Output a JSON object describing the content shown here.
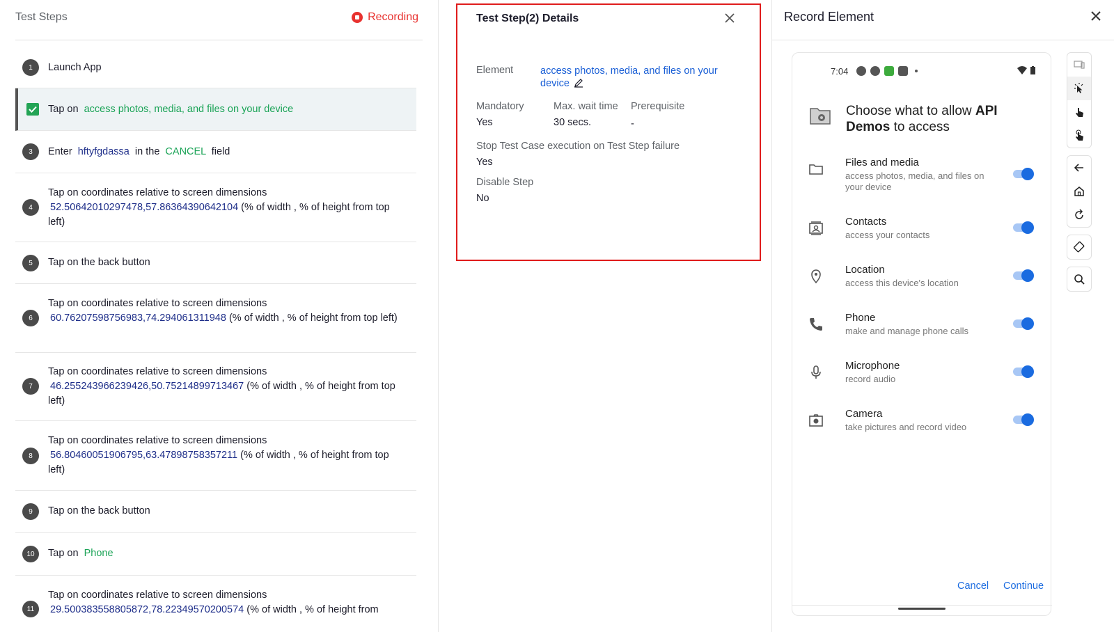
{
  "left": {
    "title": "Test Steps",
    "recording_label": "Recording",
    "steps": [
      {
        "num": "1",
        "text": "Launch App"
      },
      {
        "num": "2",
        "prefix": "Tap on",
        "element": "access photos, media, and files on your device"
      },
      {
        "num": "3",
        "prefix": "Enter",
        "value": "hftyfgdassa",
        "mid": "in the",
        "field": "CANCEL",
        "suffix": "field"
      },
      {
        "num": "4",
        "line1": "Tap on coordinates relative to screen dimensions",
        "coords": "52.50642010297478,57.86364390642104",
        "tail": "(% of width , % of height from top left)"
      },
      {
        "num": "5",
        "text": "Tap on the back button"
      },
      {
        "num": "6",
        "line1": "Tap on coordinates relative to screen dimensions",
        "coords": "60.76207598756983,74.294061311948",
        "tail": "(% of width , % of height from top left)"
      },
      {
        "num": "7",
        "line1": "Tap on coordinates relative to screen dimensions",
        "coords": "46.255243966239426,50.75214899713467",
        "tail": "(% of width , % of height from top left)"
      },
      {
        "num": "8",
        "line1": "Tap on coordinates relative to screen dimensions",
        "coords": "56.80460051906795,63.47898758357211",
        "tail": "(% of width , % of height from top left)"
      },
      {
        "num": "9",
        "text": "Tap on the back button"
      },
      {
        "num": "10",
        "prefix": "Tap on",
        "element": "Phone"
      },
      {
        "num": "11",
        "line1": "Tap on coordinates relative to screen dimensions",
        "coords": "29.500383558805872,78.22349570200574",
        "tail": "(% of width , % of height from"
      }
    ]
  },
  "details": {
    "title": "Test Step(2) Details",
    "element_label": "Element",
    "element_value_line1": "access photos, media, and files on your",
    "element_value_line2": "device",
    "mandatory_label": "Mandatory",
    "mandatory_value": "Yes",
    "wait_label": "Max. wait time",
    "wait_value": "30 secs.",
    "prereq_label": "Prerequisite",
    "prereq_value": "-",
    "stop_label": "Stop Test Case execution on Test Step failure",
    "stop_value": "Yes",
    "disable_label": "Disable Step",
    "disable_value": "No"
  },
  "record": {
    "title": "Record Element",
    "device": {
      "time": "7:04",
      "dialog_title_a": "Choose what to allow ",
      "dialog_title_b": "API Demos",
      "dialog_title_c": " to access",
      "permissions": [
        {
          "name": "Files and media",
          "desc": "access photos, media, and files on your device",
          "icon": "folder-icon",
          "enabled": true
        },
        {
          "name": "Contacts",
          "desc": "access your contacts",
          "icon": "contacts-icon",
          "enabled": true
        },
        {
          "name": "Location",
          "desc": "access this device's location",
          "icon": "location-icon",
          "enabled": true
        },
        {
          "name": "Phone",
          "desc": "make and manage phone calls",
          "icon": "phone-icon",
          "enabled": true
        },
        {
          "name": "Microphone",
          "desc": "record audio",
          "icon": "microphone-icon",
          "enabled": true
        },
        {
          "name": "Camera",
          "desc": "take pictures and record video",
          "icon": "camera-icon",
          "enabled": true
        }
      ],
      "cancel_label": "Cancel",
      "continue_label": "Continue"
    }
  },
  "colors": {
    "recording": "#e8322f",
    "highlight_border": "#e01c1c",
    "link": "#1a5fd6",
    "element_green": "#1aa356",
    "toggle_on": "#1a6be0"
  }
}
